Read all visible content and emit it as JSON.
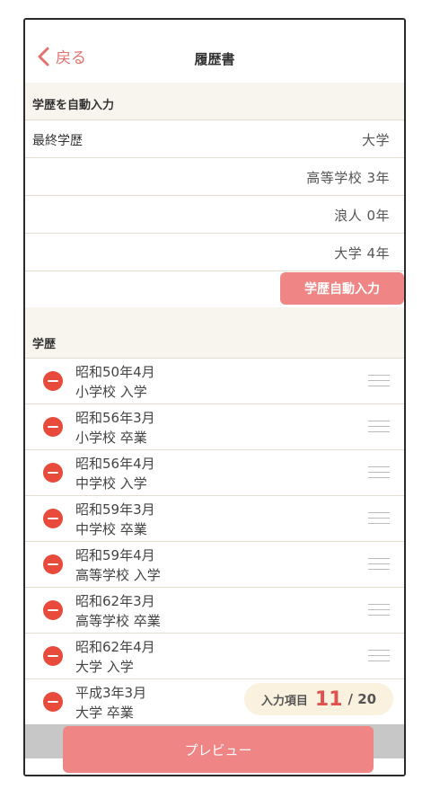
{
  "nav": {
    "back_label": "戻る",
    "title": "履歴書"
  },
  "auto": {
    "section_title": "学歴を自動入力",
    "final_label": "最終学歴",
    "final_value": "大学",
    "items": [
      "高等学校 3年",
      "浪人 0年",
      "大学 4年"
    ],
    "button_label": "学歴自動入力"
  },
  "history": {
    "section_title": "学歴",
    "rows": [
      {
        "date": "昭和50年4月",
        "event": "小学校 入学"
      },
      {
        "date": "昭和56年3月",
        "event": "小学校 卒業"
      },
      {
        "date": "昭和56年4月",
        "event": "中学校 入学"
      },
      {
        "date": "昭和59年3月",
        "event": "中学校 卒業"
      },
      {
        "date": "昭和59年4月",
        "event": "高等学校 入学"
      },
      {
        "date": "昭和62年3月",
        "event": "高等学校 卒業"
      },
      {
        "date": "昭和62年4月",
        "event": "大学 入学"
      },
      {
        "date": "平成3年3月",
        "event": "大学 卒業"
      }
    ]
  },
  "counter": {
    "label": "入力項目",
    "current": "11",
    "total": "/ 20"
  },
  "footer": {
    "preview_label": "プレビュー"
  },
  "colors": {
    "accent": "#ef8585",
    "delete": "#e84b3c",
    "section_bg": "#f8f5ee",
    "counter_bg": "#faf2de"
  }
}
